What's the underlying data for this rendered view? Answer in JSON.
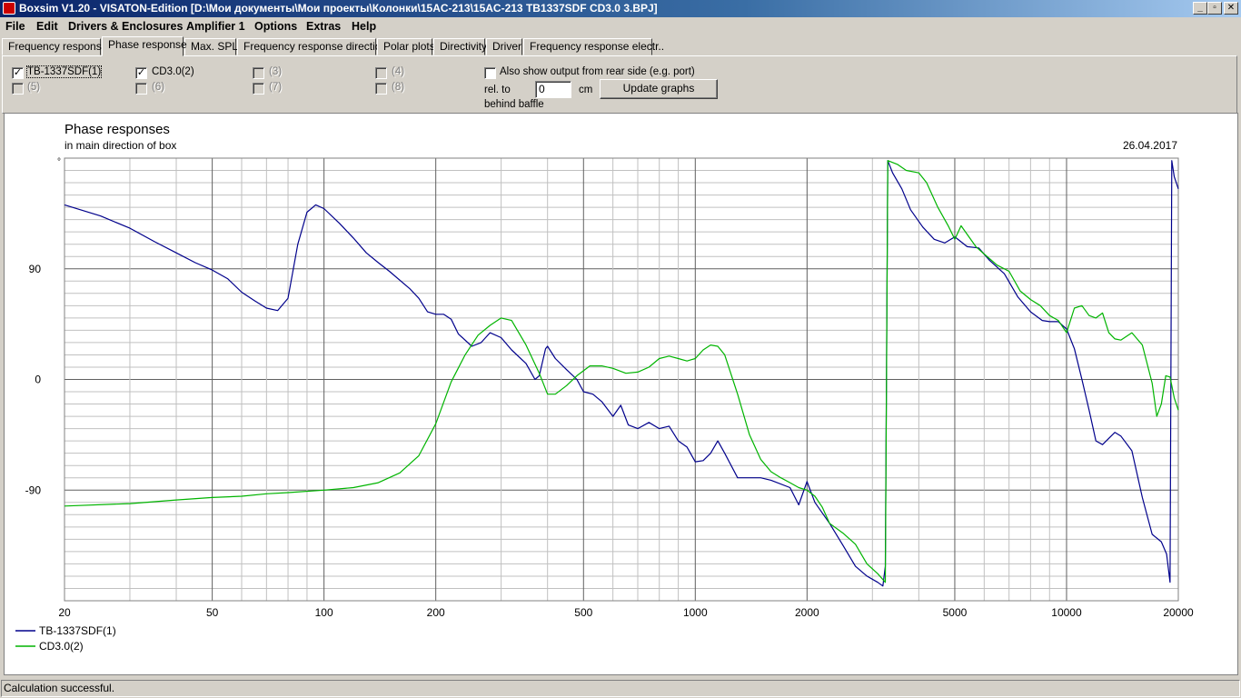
{
  "window": {
    "title": "Boxsim V1.20 - VISATON-Edition [D:\\Мои документы\\Мои проекты\\Колонки\\15AC-213\\15AC-213 TB1337SDF CD3.0 3.BPJ]",
    "minimize_glyph": "_",
    "restore_glyph": "▫",
    "close_glyph": "✕"
  },
  "menu": {
    "items": [
      "File",
      "Edit",
      "Drivers & Enclosures",
      "Amplifier 1",
      "Options",
      "Extras",
      "Help"
    ]
  },
  "tabs": {
    "items": [
      "Frequency response.",
      "Phase response",
      "Max. SPL",
      "Frequency response directions",
      "Polar plots",
      "Directivity",
      "Driver",
      "Frequency response electr.."
    ],
    "active": "Phase response"
  },
  "options": {
    "drivers": [
      {
        "label": "TB-1337SDF(1)",
        "checked": true,
        "enabled": true
      },
      {
        "label": "CD3.0(2)",
        "checked": true,
        "enabled": true
      },
      {
        "label": "(3)",
        "checked": false,
        "enabled": false
      },
      {
        "label": "(4)",
        "checked": false,
        "enabled": false
      },
      {
        "label": "(5)",
        "checked": false,
        "enabled": false
      },
      {
        "label": "(6)",
        "checked": false,
        "enabled": false
      },
      {
        "label": "(7)",
        "checked": false,
        "enabled": false
      },
      {
        "label": "(8)",
        "checked": false,
        "enabled": false
      }
    ],
    "rear_side_label": "Also show output from rear side (e.g. port)",
    "rear_side_checked": false,
    "rel_to_label": "rel. to",
    "behind_baffle_label": "behind baffle",
    "offset_value": "0",
    "offset_unit": "cm",
    "update_button": "Update graphs"
  },
  "chart": {
    "title": "Phase responses",
    "subtitle": "in main direction of box",
    "date": "26.04.2017",
    "y_unit_marker": "°"
  },
  "chart_data": {
    "type": "line",
    "title": "Phase responses",
    "subtitle": "in main direction of box",
    "x_scale": "log",
    "xlim": [
      20,
      20000
    ],
    "ylim": [
      -180,
      180
    ],
    "x_ticks": [
      20,
      50,
      100,
      200,
      500,
      1000,
      2000,
      5000,
      10000,
      20000
    ],
    "x_tick_labels": [
      "20",
      "50",
      "100",
      "200",
      "500",
      "1000",
      "2000",
      "5000",
      "10000",
      "20000"
    ],
    "y_ticks": [
      -90,
      0,
      90
    ],
    "y_tick_labels": [
      "-90",
      "0",
      "90"
    ],
    "grid": true,
    "legend_position": "bottom-left",
    "series": [
      {
        "name": "TB-1337SDF(1)",
        "color": "#00008b",
        "points": [
          [
            20,
            142
          ],
          [
            25,
            133
          ],
          [
            30,
            123
          ],
          [
            35,
            112
          ],
          [
            40,
            103
          ],
          [
            45,
            95
          ],
          [
            50,
            89
          ],
          [
            55,
            82
          ],
          [
            60,
            71
          ],
          [
            65,
            64
          ],
          [
            70,
            58
          ],
          [
            75,
            56
          ],
          [
            80,
            66
          ],
          [
            85,
            110
          ],
          [
            90,
            136
          ],
          [
            95,
            142
          ],
          [
            100,
            139
          ],
          [
            110,
            127
          ],
          [
            120,
            115
          ],
          [
            130,
            103
          ],
          [
            140,
            95
          ],
          [
            150,
            88
          ],
          [
            170,
            74
          ],
          [
            180,
            66
          ],
          [
            190,
            55
          ],
          [
            200,
            53
          ],
          [
            210,
            53
          ],
          [
            220,
            49
          ],
          [
            230,
            37
          ],
          [
            250,
            27
          ],
          [
            265,
            30
          ],
          [
            280,
            38
          ],
          [
            300,
            34
          ],
          [
            320,
            24
          ],
          [
            350,
            13
          ],
          [
            370,
            0
          ],
          [
            380,
            3
          ],
          [
            395,
            25
          ],
          [
            400,
            27
          ],
          [
            420,
            17
          ],
          [
            450,
            8
          ],
          [
            480,
            0
          ],
          [
            500,
            -10
          ],
          [
            530,
            -12
          ],
          [
            560,
            -18
          ],
          [
            600,
            -30
          ],
          [
            630,
            -21
          ],
          [
            660,
            -37
          ],
          [
            700,
            -40
          ],
          [
            750,
            -35
          ],
          [
            800,
            -40
          ],
          [
            850,
            -38
          ],
          [
            900,
            -50
          ],
          [
            950,
            -55
          ],
          [
            1000,
            -67
          ],
          [
            1050,
            -66
          ],
          [
            1100,
            -60
          ],
          [
            1150,
            -50
          ],
          [
            1200,
            -60
          ],
          [
            1300,
            -80
          ],
          [
            1400,
            -80
          ],
          [
            1500,
            -80
          ],
          [
            1600,
            -82
          ],
          [
            1800,
            -88
          ],
          [
            1900,
            -102
          ],
          [
            2000,
            -83
          ],
          [
            2100,
            -100
          ],
          [
            2300,
            -117
          ],
          [
            2500,
            -135
          ],
          [
            2700,
            -152
          ],
          [
            2900,
            -160
          ],
          [
            3100,
            -165
          ],
          [
            3200,
            -168
          ],
          [
            3250,
            -152
          ],
          [
            3300,
            178
          ],
          [
            3400,
            168
          ],
          [
            3600,
            155
          ],
          [
            3800,
            138
          ],
          [
            4100,
            124
          ],
          [
            4400,
            114
          ],
          [
            4700,
            111
          ],
          [
            5000,
            116
          ],
          [
            5400,
            108
          ],
          [
            5800,
            107
          ],
          [
            6200,
            97
          ],
          [
            6800,
            86
          ],
          [
            7400,
            67
          ],
          [
            8000,
            55
          ],
          [
            8600,
            48
          ],
          [
            9000,
            47
          ],
          [
            9500,
            47
          ],
          [
            10000,
            41
          ],
          [
            10500,
            25
          ],
          [
            11000,
            0
          ],
          [
            11500,
            -25
          ],
          [
            12000,
            -50
          ],
          [
            12500,
            -53
          ],
          [
            13500,
            -43
          ],
          [
            14000,
            -46
          ],
          [
            15000,
            -58
          ],
          [
            16000,
            -96
          ],
          [
            17000,
            -126
          ],
          [
            18000,
            -132
          ],
          [
            18600,
            -142
          ],
          [
            19000,
            -165
          ],
          [
            19200,
            178
          ],
          [
            19500,
            165
          ],
          [
            20000,
            155
          ]
        ]
      },
      {
        "name": "CD3.0(2)",
        "color": "#00b400",
        "points": [
          [
            20,
            -103
          ],
          [
            30,
            -101
          ],
          [
            40,
            -98
          ],
          [
            50,
            -96
          ],
          [
            60,
            -95
          ],
          [
            70,
            -93
          ],
          [
            80,
            -92
          ],
          [
            100,
            -90
          ],
          [
            120,
            -88
          ],
          [
            140,
            -84
          ],
          [
            160,
            -76
          ],
          [
            180,
            -62
          ],
          [
            200,
            -36
          ],
          [
            220,
            -2
          ],
          [
            240,
            20
          ],
          [
            260,
            36
          ],
          [
            280,
            44
          ],
          [
            300,
            50
          ],
          [
            320,
            48
          ],
          [
            350,
            28
          ],
          [
            380,
            5
          ],
          [
            400,
            -12
          ],
          [
            420,
            -12
          ],
          [
            450,
            -5
          ],
          [
            480,
            3
          ],
          [
            520,
            11
          ],
          [
            560,
            11
          ],
          [
            600,
            9
          ],
          [
            650,
            5
          ],
          [
            700,
            6
          ],
          [
            750,
            10
          ],
          [
            800,
            17
          ],
          [
            850,
            19
          ],
          [
            900,
            17
          ],
          [
            950,
            15
          ],
          [
            1000,
            17
          ],
          [
            1050,
            24
          ],
          [
            1100,
            28
          ],
          [
            1150,
            27
          ],
          [
            1200,
            20
          ],
          [
            1300,
            -12
          ],
          [
            1400,
            -45
          ],
          [
            1500,
            -65
          ],
          [
            1600,
            -75
          ],
          [
            1700,
            -80
          ],
          [
            1800,
            -84
          ],
          [
            1900,
            -88
          ],
          [
            2000,
            -90
          ],
          [
            2100,
            -95
          ],
          [
            2200,
            -104
          ],
          [
            2300,
            -117
          ],
          [
            2500,
            -125
          ],
          [
            2700,
            -134
          ],
          [
            2900,
            -150
          ],
          [
            3100,
            -158
          ],
          [
            3250,
            -165
          ],
          [
            3300,
            178
          ],
          [
            3500,
            175
          ],
          [
            3700,
            170
          ],
          [
            4000,
            168
          ],
          [
            4200,
            160
          ],
          [
            4500,
            140
          ],
          [
            4800,
            125
          ],
          [
            5000,
            114
          ],
          [
            5200,
            125
          ],
          [
            5400,
            118
          ],
          [
            5700,
            108
          ],
          [
            6000,
            102
          ],
          [
            6500,
            93
          ],
          [
            7000,
            88
          ],
          [
            7500,
            72
          ],
          [
            8000,
            65
          ],
          [
            8500,
            60
          ],
          [
            9000,
            52
          ],
          [
            9500,
            48
          ],
          [
            10000,
            38
          ],
          [
            10500,
            58
          ],
          [
            11000,
            60
          ],
          [
            11500,
            52
          ],
          [
            12000,
            50
          ],
          [
            12500,
            54
          ],
          [
            13000,
            38
          ],
          [
            13500,
            33
          ],
          [
            14000,
            32
          ],
          [
            15000,
            38
          ],
          [
            16000,
            28
          ],
          [
            17000,
            -3
          ],
          [
            17500,
            -30
          ],
          [
            18000,
            -20
          ],
          [
            18500,
            3
          ],
          [
            19000,
            2
          ],
          [
            19500,
            -15
          ],
          [
            20000,
            -25
          ]
        ]
      }
    ]
  },
  "status": {
    "text": "Calculation successful."
  }
}
